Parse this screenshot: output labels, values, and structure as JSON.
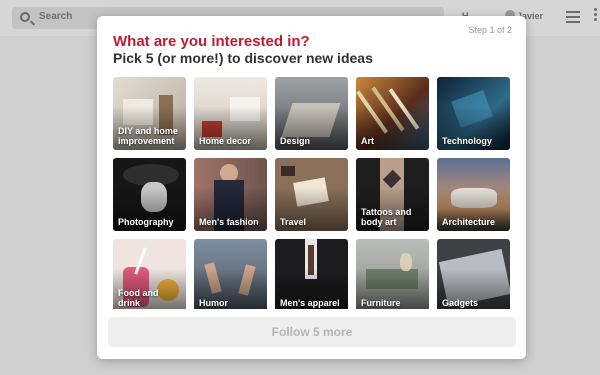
{
  "header": {
    "search_placeholder": "Search",
    "home_label": "H",
    "user_label": "Javier"
  },
  "modal": {
    "step": "Step 1 of 2",
    "title": "What are you interested in?",
    "subtitle": "Pick 5 (or more!) to discover new ideas",
    "topics": [
      {
        "label": "DIY and home improvement",
        "bg": "#c9c2b6"
      },
      {
        "label": "Home decor",
        "bg": "#d8d2c8"
      },
      {
        "label": "Design",
        "bg": "#8c8f91"
      },
      {
        "label": "Art",
        "bg": "#7a4a2a"
      },
      {
        "label": "Technology",
        "bg": "#1f3a52"
      },
      {
        "label": "Photography",
        "bg": "#2a2a2a"
      },
      {
        "label": "Men's fashion",
        "bg": "#5a4a44"
      },
      {
        "label": "Travel",
        "bg": "#7a6550"
      },
      {
        "label": "Tattoos and body art",
        "bg": "#3a3a3a"
      },
      {
        "label": "Architecture",
        "bg": "#4a4a5e"
      },
      {
        "label": "Food and drink",
        "bg": "#e7d7d2"
      },
      {
        "label": "Humor",
        "bg": "#5e6a78"
      },
      {
        "label": "Men's apparel",
        "bg": "#2b2b2e"
      },
      {
        "label": "Furniture",
        "bg": "#a7aaa6"
      },
      {
        "label": "Gadgets",
        "bg": "#7b7e84"
      }
    ],
    "follow_button": "Follow 5 more"
  }
}
